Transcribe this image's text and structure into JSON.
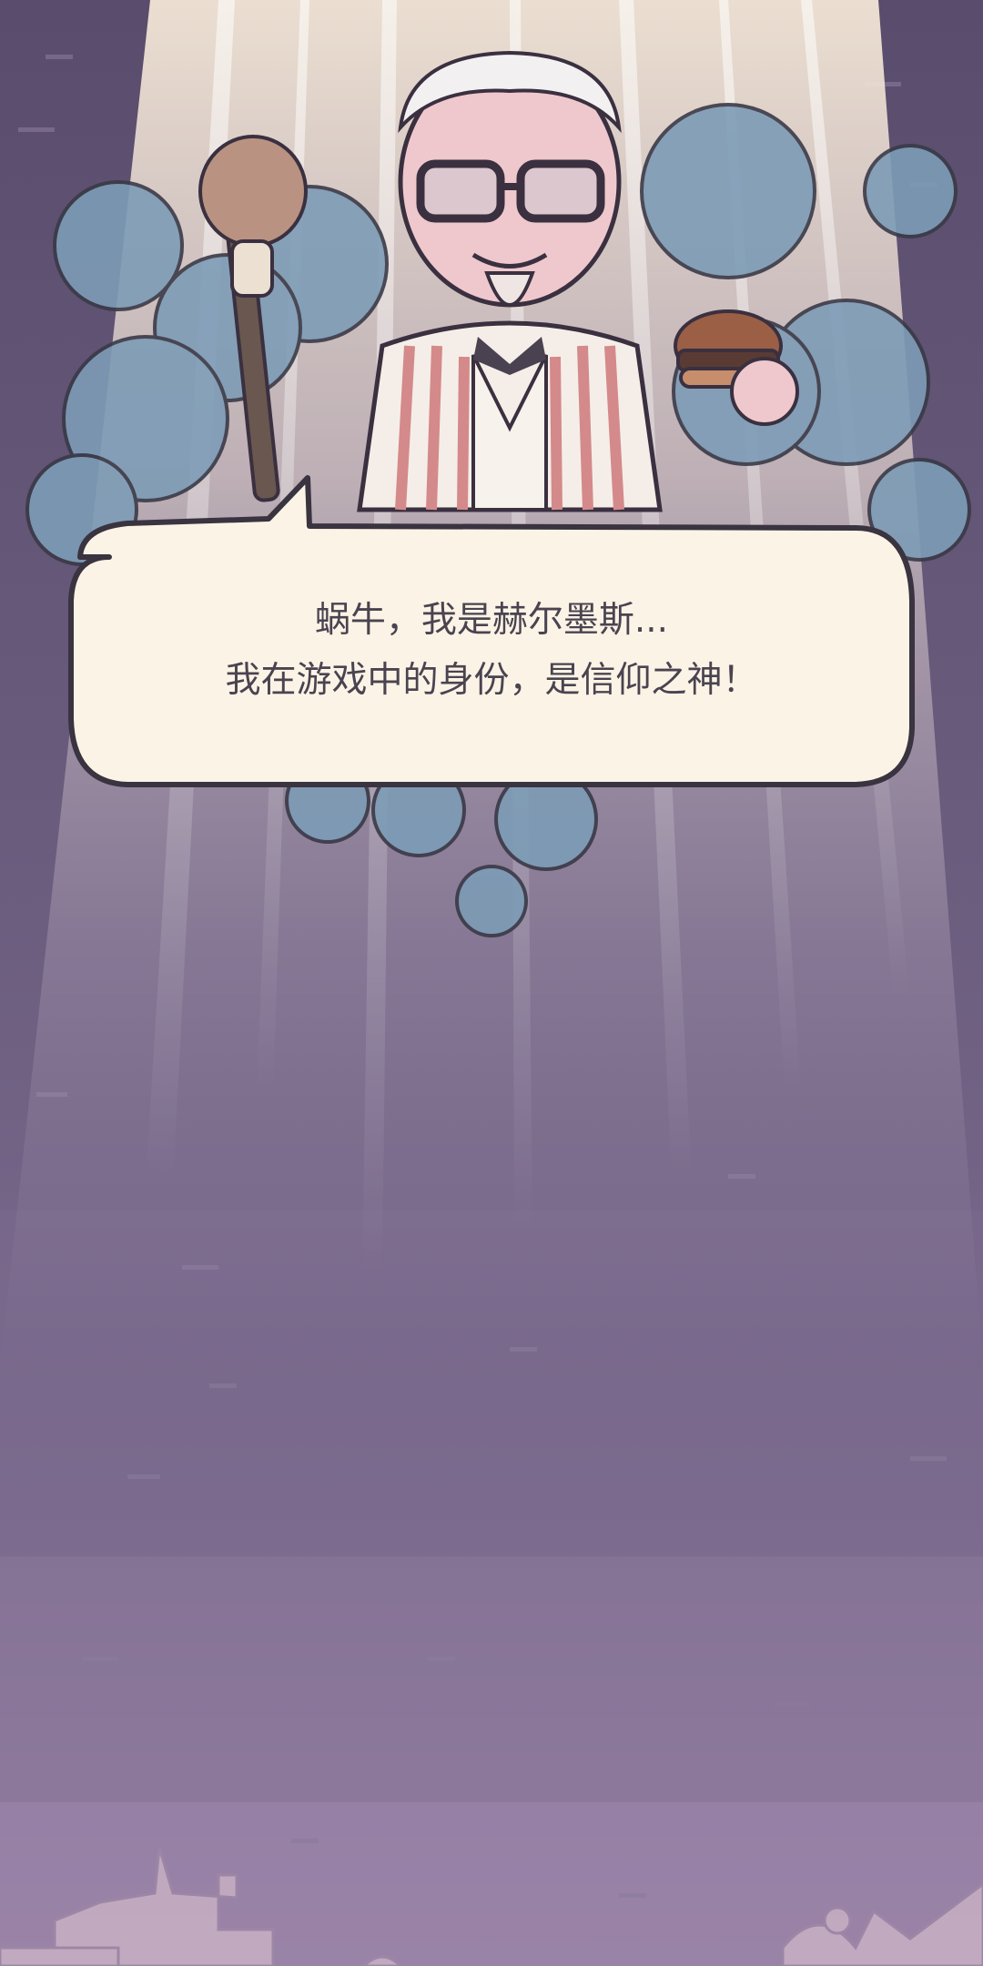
{
  "dialog": {
    "line1": "蜗牛，我是赫尔墨斯...",
    "line2": "我在游戏中的身份，是信仰之神！"
  },
  "colors": {
    "background_top": "#5b4e6e",
    "background_bottom": "#9b84a8",
    "bubble_fill": "#fbf4e6",
    "bubble_stroke": "#3a3340",
    "text": "#4a4350",
    "cloud": "#7d9cb6"
  },
  "icons": {
    "character": "hermes-god-character-icon",
    "staff": "drumstick-staff-icon",
    "burger": "burger-icon",
    "clouds": "cloud-icon"
  }
}
